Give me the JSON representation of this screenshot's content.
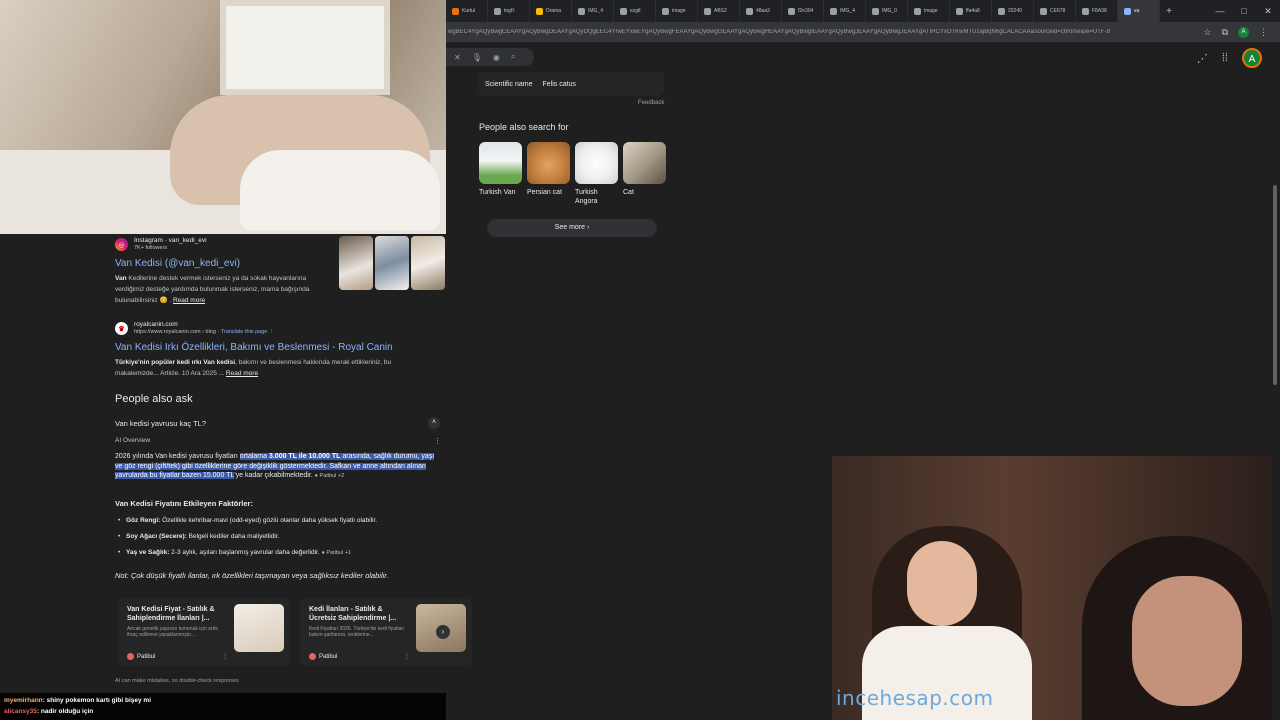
{
  "browser": {
    "tabs": [
      {
        "label": "Kurtul",
        "color": "#e8710a"
      },
      {
        "label": "togIf.",
        "color": "#9aa0a6"
      },
      {
        "label": "Drama",
        "color": "#fbbc04"
      },
      {
        "label": "IMG_4",
        "color": "#9aa0a6"
      },
      {
        "label": "ezgif.",
        "color": "#9aa0a6"
      },
      {
        "label": "image",
        "color": "#9aa0a6"
      },
      {
        "label": "ABS2",
        "color": "#9aa0a6"
      },
      {
        "label": "48aa2",
        "color": "#9aa0a6"
      },
      {
        "label": "f2e304",
        "color": "#9aa0a6"
      },
      {
        "label": "IMG_4",
        "color": "#9aa0a6"
      },
      {
        "label": "IMG_0",
        "color": "#9aa0a6"
      },
      {
        "label": "image",
        "color": "#9aa0a6"
      },
      {
        "label": "ffa4a8",
        "color": "#9aa0a6"
      },
      {
        "label": "20240",
        "color": "#9aa0a6"
      },
      {
        "label": "CE678",
        "color": "#9aa0a6"
      },
      {
        "label": "F8A38",
        "color": "#9aa0a6"
      },
      {
        "label": "va",
        "color": "#8ab4f8"
      }
    ],
    "url": "wgBEC4YgAQyBwgCEAAYgAQyBwgDEAAYgAQyDQgEEC4YrwEYxwEYgAQyBwgFEAAYgAQyBwgGEAAYgAQyBwgHEAAYgAQyBwgIEAAYgAQyBwgJEAAYgAQyBwgJEAAYgATIHCYxOTKwMTUzajBqN6gCALACAA&sourceid=chrome&ie=UTF-8",
    "profile_letter": "A"
  },
  "knowledge_panel": {
    "sci_key": "Scientific name",
    "sci_value": "Felis catus",
    "feedback": "Feedback",
    "pas_title": "People also search for",
    "pas_items": [
      {
        "name": "Turkish Van"
      },
      {
        "name": "Persian cat"
      },
      {
        "name": "Turkish Angora"
      },
      {
        "name": "Cat"
      }
    ],
    "see_more": "See more"
  },
  "results": {
    "insta": {
      "site": "Instagram · van_kedi_evi",
      "followers": "7K+ followers",
      "title": "Van Kedisi (@van_kedi_evi)",
      "snippet_bold": "Van",
      "snippet": " Kedilerine destek vermek isterseniz ya da sokak hayvanlarına verdiğimiz desteğe yardımda bulunmak isterseniz, mama bağışında bulunabilirsiniz 😊 . ",
      "read_more": "Read more"
    },
    "royal": {
      "site": "royalcanin.com",
      "url": "https://www.royalcanin.com › blog",
      "translate": "Translate this page",
      "title": "Van Kedisi Irkı Özellikleri, Bakımı ve Beslenmesi - Royal Canin",
      "snippet_bold": "Türkiye'nin popüler kedi ırkı Van kedisi",
      "snippet": ", bakımı ve beslenmesi hakkında merak ettikleriniz, bu makalemizde... Article. 10 Ara 2025 ... ",
      "read_more": "Read more"
    }
  },
  "paa": {
    "title": "People also ask",
    "question": "Van kedisi yavrusu kaç TL?",
    "ai_label": "AI Overview",
    "body_pre": "2026 yılında Van kedisi yavrusu fiyatları ",
    "body_hl_1": "ortalama ",
    "body_hl_b": "3.000 TL ile 10.000 TL",
    "body_hl_2": " arasında, sağlık durumu, yaşı ve göz rengi (çift/tek) gibi özelliklerine göre değişiklik göstermektedir. Safkan ve anne altından alınan yavrularda bu fiyatlar bazen 15.000 TL",
    "body_post": "'ye kadar çıkabilmektedir.",
    "cite_1": "Patibul +2",
    "factors_title": "Van Kedisi Fiyatını Etkileyen Faktörler:",
    "bullets": [
      {
        "b": "Göz Rengi:",
        "t": " Özellikle kehribar-mavi (odd-eyed) gözlü olanlar daha yüksek fiyatlı olabilir."
      },
      {
        "b": "Soy Ağacı (Secere):",
        "t": " Belgeli kediler daha maliyetlidir."
      },
      {
        "b": "Yaş ve Sağlık:",
        "t": " 2-3 aylık, aşıları başlanmış yavrular daha değerlidir.",
        "cite": "Patibul +1"
      }
    ],
    "note": "Not: Çok düşük fiyatlı ilanlar, ırk özellikleri taşımayan veya sağlıksız kediler olabilir.",
    "cards": [
      {
        "title": "Van Kedisi Fiyat - Satılık & Sahiplendirme İlanları |...",
        "snippet": "Ancak genetik yapısını korumak için artık ihraç edilmesi yasaklanmıştır...",
        "source": "Patibul"
      },
      {
        "title": "Kedi İlanları - Satılık & Ücretsiz Sahiplendirme |...",
        "snippet": "Kedi Fiyatları 2026. Türkiye'de kedi fiyatları bakım şartlarına, renklerine...",
        "source": "Patibul"
      }
    ],
    "disclaimer": "AI can make mistakes, so double-check responses"
  },
  "chat": [
    {
      "user": "myemirhann",
      "msg": ": shiny pokemon kartı gibi bişey mi"
    },
    {
      "user": "alicansy35",
      "msg": ": nadir olduğu için"
    }
  ],
  "overlay_brand": "incehesap.com"
}
